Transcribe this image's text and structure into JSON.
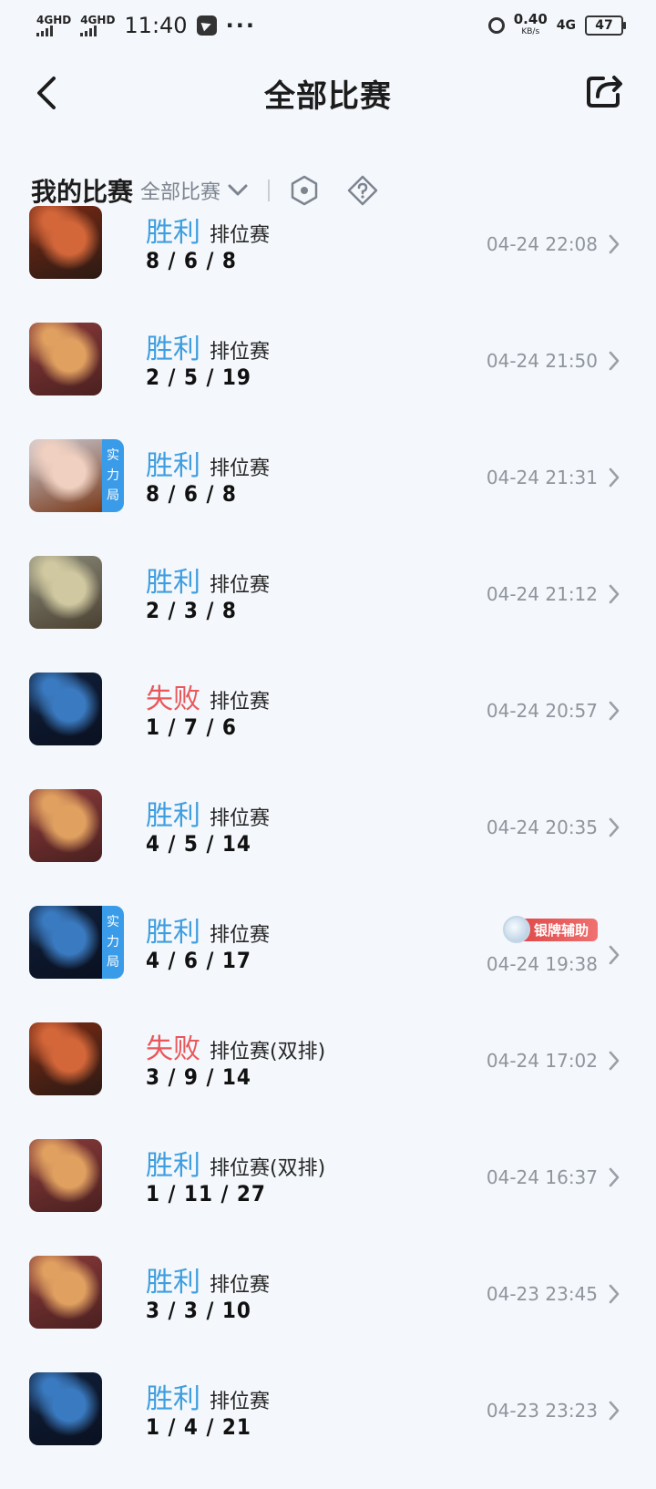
{
  "status_bar": {
    "sim1": "4GHD",
    "sim2": "4GHD",
    "time": "11:40",
    "more": "···",
    "net_speed": "0.40",
    "net_unit": "KB/s",
    "network": "4G",
    "battery": "47"
  },
  "header": {
    "title": "全部比赛"
  },
  "filter_bar": {
    "my_matches": "我的比赛",
    "selected": "全部比赛"
  },
  "matches": [
    {
      "result": "胜利",
      "type": "win",
      "mode": "排位赛",
      "kda": "8 / 6 / 8",
      "time": "04-24 22:08",
      "hero_colors": [
        "#7a2a14",
        "#d4673a",
        "#2b1a14"
      ],
      "tag": false
    },
    {
      "result": "胜利",
      "type": "win",
      "mode": "排位赛",
      "kda": "2 / 5 / 19",
      "time": "04-24 21:50",
      "hero_colors": [
        "#8a3a3a",
        "#e0a060",
        "#4a2020"
      ],
      "tag": false
    },
    {
      "result": "胜利",
      "type": "win",
      "mode": "排位赛",
      "kda": "8 / 6 / 8",
      "time": "04-24 21:31",
      "hero_colors": [
        "#c9c9d2",
        "#f0d0c0",
        "#7a3a1a"
      ],
      "tag": true,
      "tag_text": [
        "实",
        "力",
        "局"
      ]
    },
    {
      "result": "胜利",
      "type": "win",
      "mode": "排位赛",
      "kda": "2 / 3 / 8",
      "time": "04-24 21:12",
      "hero_colors": [
        "#8a8a7a",
        "#d0c8a0",
        "#4a4030"
      ],
      "tag": false
    },
    {
      "result": "失败",
      "type": "loss",
      "mode": "排位赛",
      "kda": "1 / 7 / 6",
      "time": "04-24 20:57",
      "hero_colors": [
        "#10203a",
        "#3a7ac0",
        "#0a1020"
      ],
      "tag": false
    },
    {
      "result": "胜利",
      "type": "win",
      "mode": "排位赛",
      "kda": "4 / 5 / 14",
      "time": "04-24 20:35",
      "hero_colors": [
        "#8a3a3a",
        "#e0a060",
        "#4a2020"
      ],
      "tag": false
    },
    {
      "result": "胜利",
      "type": "win",
      "mode": "排位赛",
      "kda": "4 / 6 / 17",
      "time": "04-24 19:38",
      "hero_colors": [
        "#10203a",
        "#3a7ac0",
        "#0a1020"
      ],
      "tag": true,
      "tag_text": [
        "实",
        "力",
        "局"
      ],
      "badge": "银牌辅助"
    },
    {
      "result": "失败",
      "type": "loss",
      "mode": "排位赛(双排)",
      "kda": "3 / 9 / 14",
      "time": "04-24 17:02",
      "hero_colors": [
        "#7a2a14",
        "#d4673a",
        "#2b1a14"
      ],
      "tag": false
    },
    {
      "result": "胜利",
      "type": "win",
      "mode": "排位赛(双排)",
      "kda": "1 / 11 / 27",
      "time": "04-24 16:37",
      "hero_colors": [
        "#8a3a3a",
        "#e0a060",
        "#4a2020"
      ],
      "tag": false
    },
    {
      "result": "胜利",
      "type": "win",
      "mode": "排位赛",
      "kda": "3 / 3 / 10",
      "time": "04-23 23:45",
      "hero_colors": [
        "#8a3a3a",
        "#e0a060",
        "#4a2020"
      ],
      "tag": false
    },
    {
      "result": "胜利",
      "type": "win",
      "mode": "排位赛",
      "kda": "1 / 4 / 21",
      "time": "04-23 23:23",
      "hero_colors": [
        "#10203a",
        "#3a7ac0",
        "#0a1020"
      ],
      "tag": false
    }
  ]
}
